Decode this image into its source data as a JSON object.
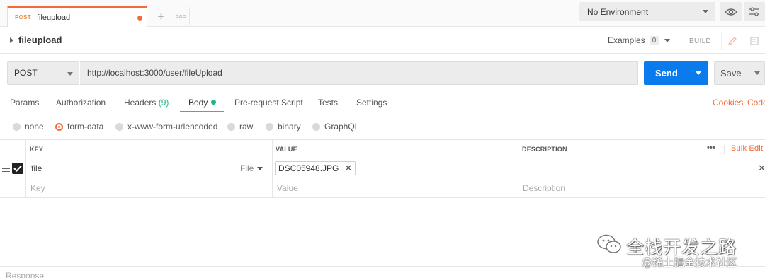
{
  "tab": {
    "method": "POST",
    "name": "fileupload"
  },
  "environment": {
    "selected": "No Environment"
  },
  "request": {
    "name": "fileupload",
    "examples_label": "Examples",
    "examples_count": "0",
    "build_label": "BUILD",
    "method": "POST",
    "url": "http://localhost:3000/user/fileUpload",
    "send_label": "Send",
    "save_label": "Save"
  },
  "request_tabs": {
    "params": "Params",
    "authorization": "Authorization",
    "headers": "Headers",
    "headers_count": "(9)",
    "body": "Body",
    "pre_request": "Pre-request Script",
    "tests": "Tests",
    "settings": "Settings",
    "cookies": "Cookies",
    "code": "Code"
  },
  "body_types": {
    "selected": "form-data",
    "options": [
      "none",
      "form-data",
      "x-www-form-urlencoded",
      "raw",
      "binary",
      "GraphQL"
    ]
  },
  "table": {
    "headers": {
      "key": "KEY",
      "value": "VALUE",
      "description": "DESCRIPTION"
    },
    "bulk_edit": "Bulk Edit",
    "more": "•••",
    "rows": [
      {
        "key": "file",
        "type": "File",
        "value": "DSC05948.JPG",
        "checked": true
      }
    ],
    "placeholders": {
      "key": "Key",
      "value": "Value",
      "description": "Description"
    }
  },
  "response": {
    "label": "Response"
  },
  "watermark": {
    "title": "全栈开发之路",
    "subtitle": "@稀土掘金技术社区"
  },
  "colors": {
    "accent": "#f26b3a",
    "send": "#097bed",
    "success": "#26b47f"
  }
}
